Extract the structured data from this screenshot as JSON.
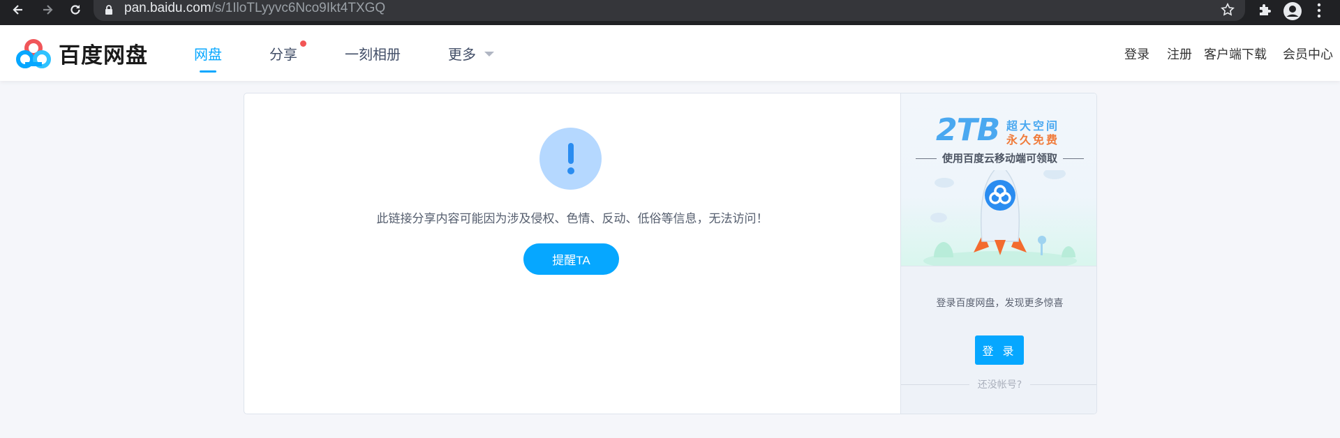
{
  "browser": {
    "url_host": "pan.baidu.com",
    "url_path": "/s/1IloTLyyvc6Nco9Ikt4TXGQ"
  },
  "nav": {
    "logo_text": "百度网盘",
    "items": [
      {
        "label": "网盘",
        "active": true
      },
      {
        "label": "分享",
        "has_dot": true
      },
      {
        "label": "一刻相册"
      },
      {
        "label": "更多",
        "has_dropdown": true
      }
    ],
    "right_links": [
      "登录",
      "注册",
      "客户端下载",
      "会员中心"
    ]
  },
  "main": {
    "message": "此链接分享内容可能因为涉及侵权、色情、反动、低俗等信息，无法访问！",
    "remind_button": "提醒TA"
  },
  "sidebar": {
    "promo_big": "2TB",
    "promo_line1": "超大空间",
    "promo_line2": "永久免费",
    "promo_tagline": "使用百度云移动端可领取",
    "login_tip": "登录百度网盘，发现更多惊喜",
    "login_button": "登 录",
    "no_account": "还没帐号?"
  },
  "colors": {
    "accent": "#06a7ff",
    "warning_circle": "#b5d8ff",
    "red_dot": "#f25555"
  }
}
